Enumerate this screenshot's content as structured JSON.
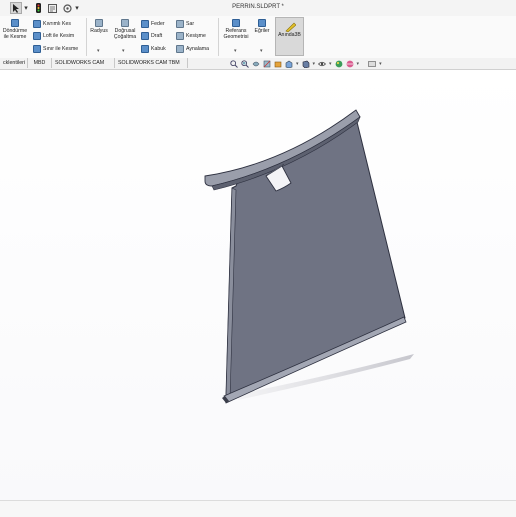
{
  "window": {
    "title": "PERRIN.SLDPRT *"
  },
  "ribbon": {
    "revolve_cut": {
      "line1": "Döndürme",
      "line2": "ile Kesme"
    },
    "swept_cut": "Kıvrımlı Kes",
    "loft_cut": "Loft ile Kesim",
    "boundary_cut": "Sınır ile Kesme",
    "fillet": "Radyus",
    "linear_pattern": {
      "line1": "Doğrusal",
      "line2": "Çoğaltma"
    },
    "rib": "Feder",
    "draft": "Draft",
    "shell": "Kabuk",
    "wrap": "Sar",
    "intersect": "Kesişme",
    "mirror": "Aynalama",
    "ref_geometry": {
      "line1": "Referans",
      "line2": "Geometrisi"
    },
    "curves": "Eğriler",
    "instant3d": "Anında3B"
  },
  "tabs": [
    "cklentileri",
    "MBD",
    "SOLIDWORKS CAM",
    "SOLIDWORKS CAM TBM"
  ],
  "colors": {
    "part_face": "#6f7383",
    "part_edge": "#2e3140",
    "ribbon_bg": "#fafafa"
  }
}
